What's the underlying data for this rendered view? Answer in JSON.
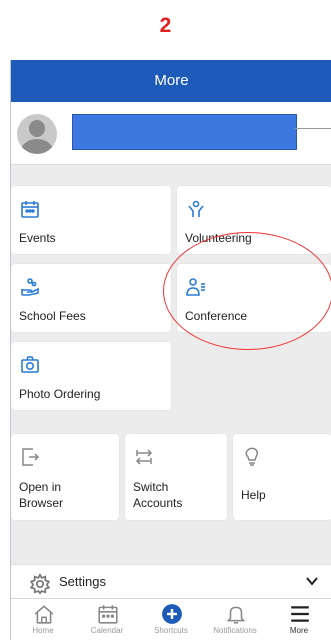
{
  "annotation": {
    "step_number": "2"
  },
  "header": {
    "title": "More"
  },
  "tiles": {
    "events": "Events",
    "volunteering": "Volunteering",
    "school_fees": "School Fees",
    "conference": "Conference",
    "photo_ordering": "Photo Ordering"
  },
  "actions": {
    "open_browser_line1": "Open in",
    "open_browser_line2": "Browser",
    "switch_line1": "Switch",
    "switch_line2": "Accounts",
    "help": "Help"
  },
  "settings": {
    "label": "Settings"
  },
  "tabbar": {
    "home": "Home",
    "calendar": "Calendar",
    "shortcuts": "Shortcuts",
    "notifications": "Notifications",
    "more": "More"
  },
  "colors": {
    "brand": "#1e5bb8",
    "accent": "#2a7bd6",
    "annotation": "#e02020"
  }
}
